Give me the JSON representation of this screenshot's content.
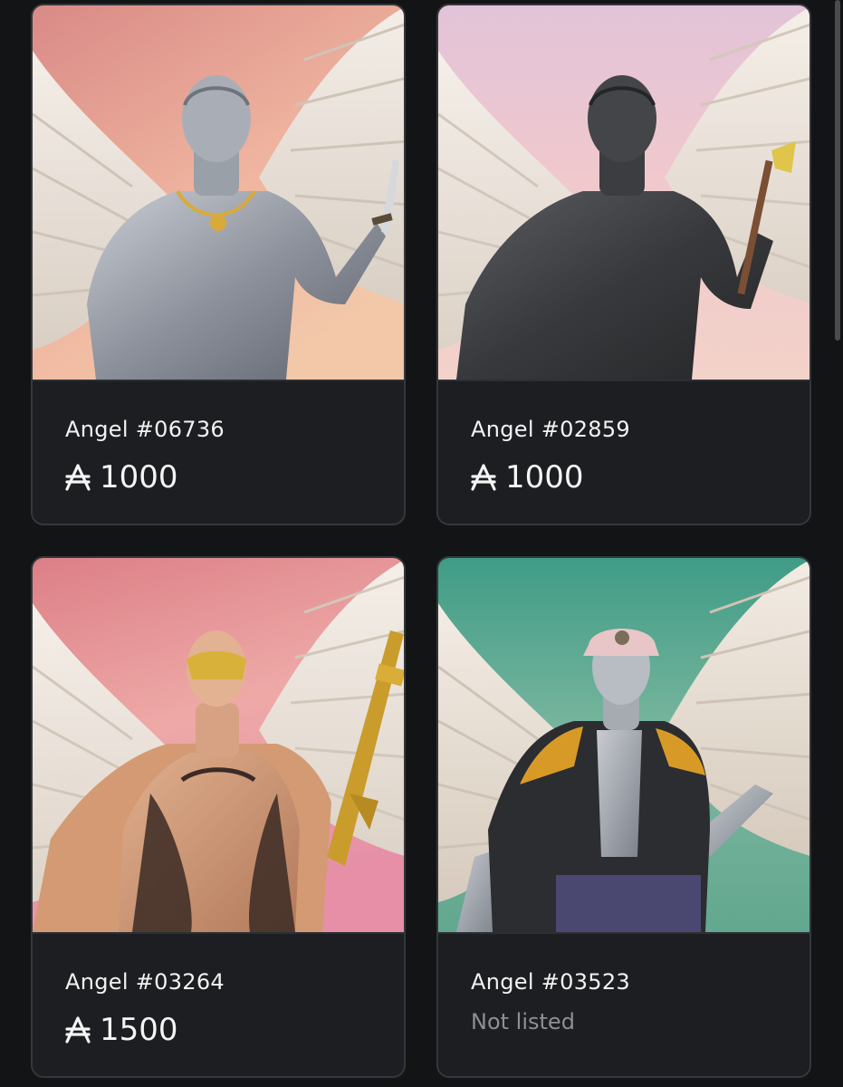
{
  "gallery": {
    "currency_icon": "ada-icon",
    "cards": [
      {
        "name": "Angel #06736",
        "price": "1000",
        "status": "",
        "background": "#e8a79a",
        "skin": "silver",
        "item": "dagger-icon"
      },
      {
        "name": "Angel #02859",
        "price": "1000",
        "status": "",
        "background": "#eec7cb",
        "skin": "dark",
        "item": "axe-icon"
      },
      {
        "name": "Angel #03264",
        "price": "1500",
        "status": "",
        "background": "#e69b9c",
        "skin": "tan",
        "item": "rifle-icon"
      },
      {
        "name": "Angel #03523",
        "price": "",
        "status": "Not listed",
        "background": "#5fa68e",
        "skin": "silver",
        "item": "jacket-icon"
      }
    ]
  }
}
